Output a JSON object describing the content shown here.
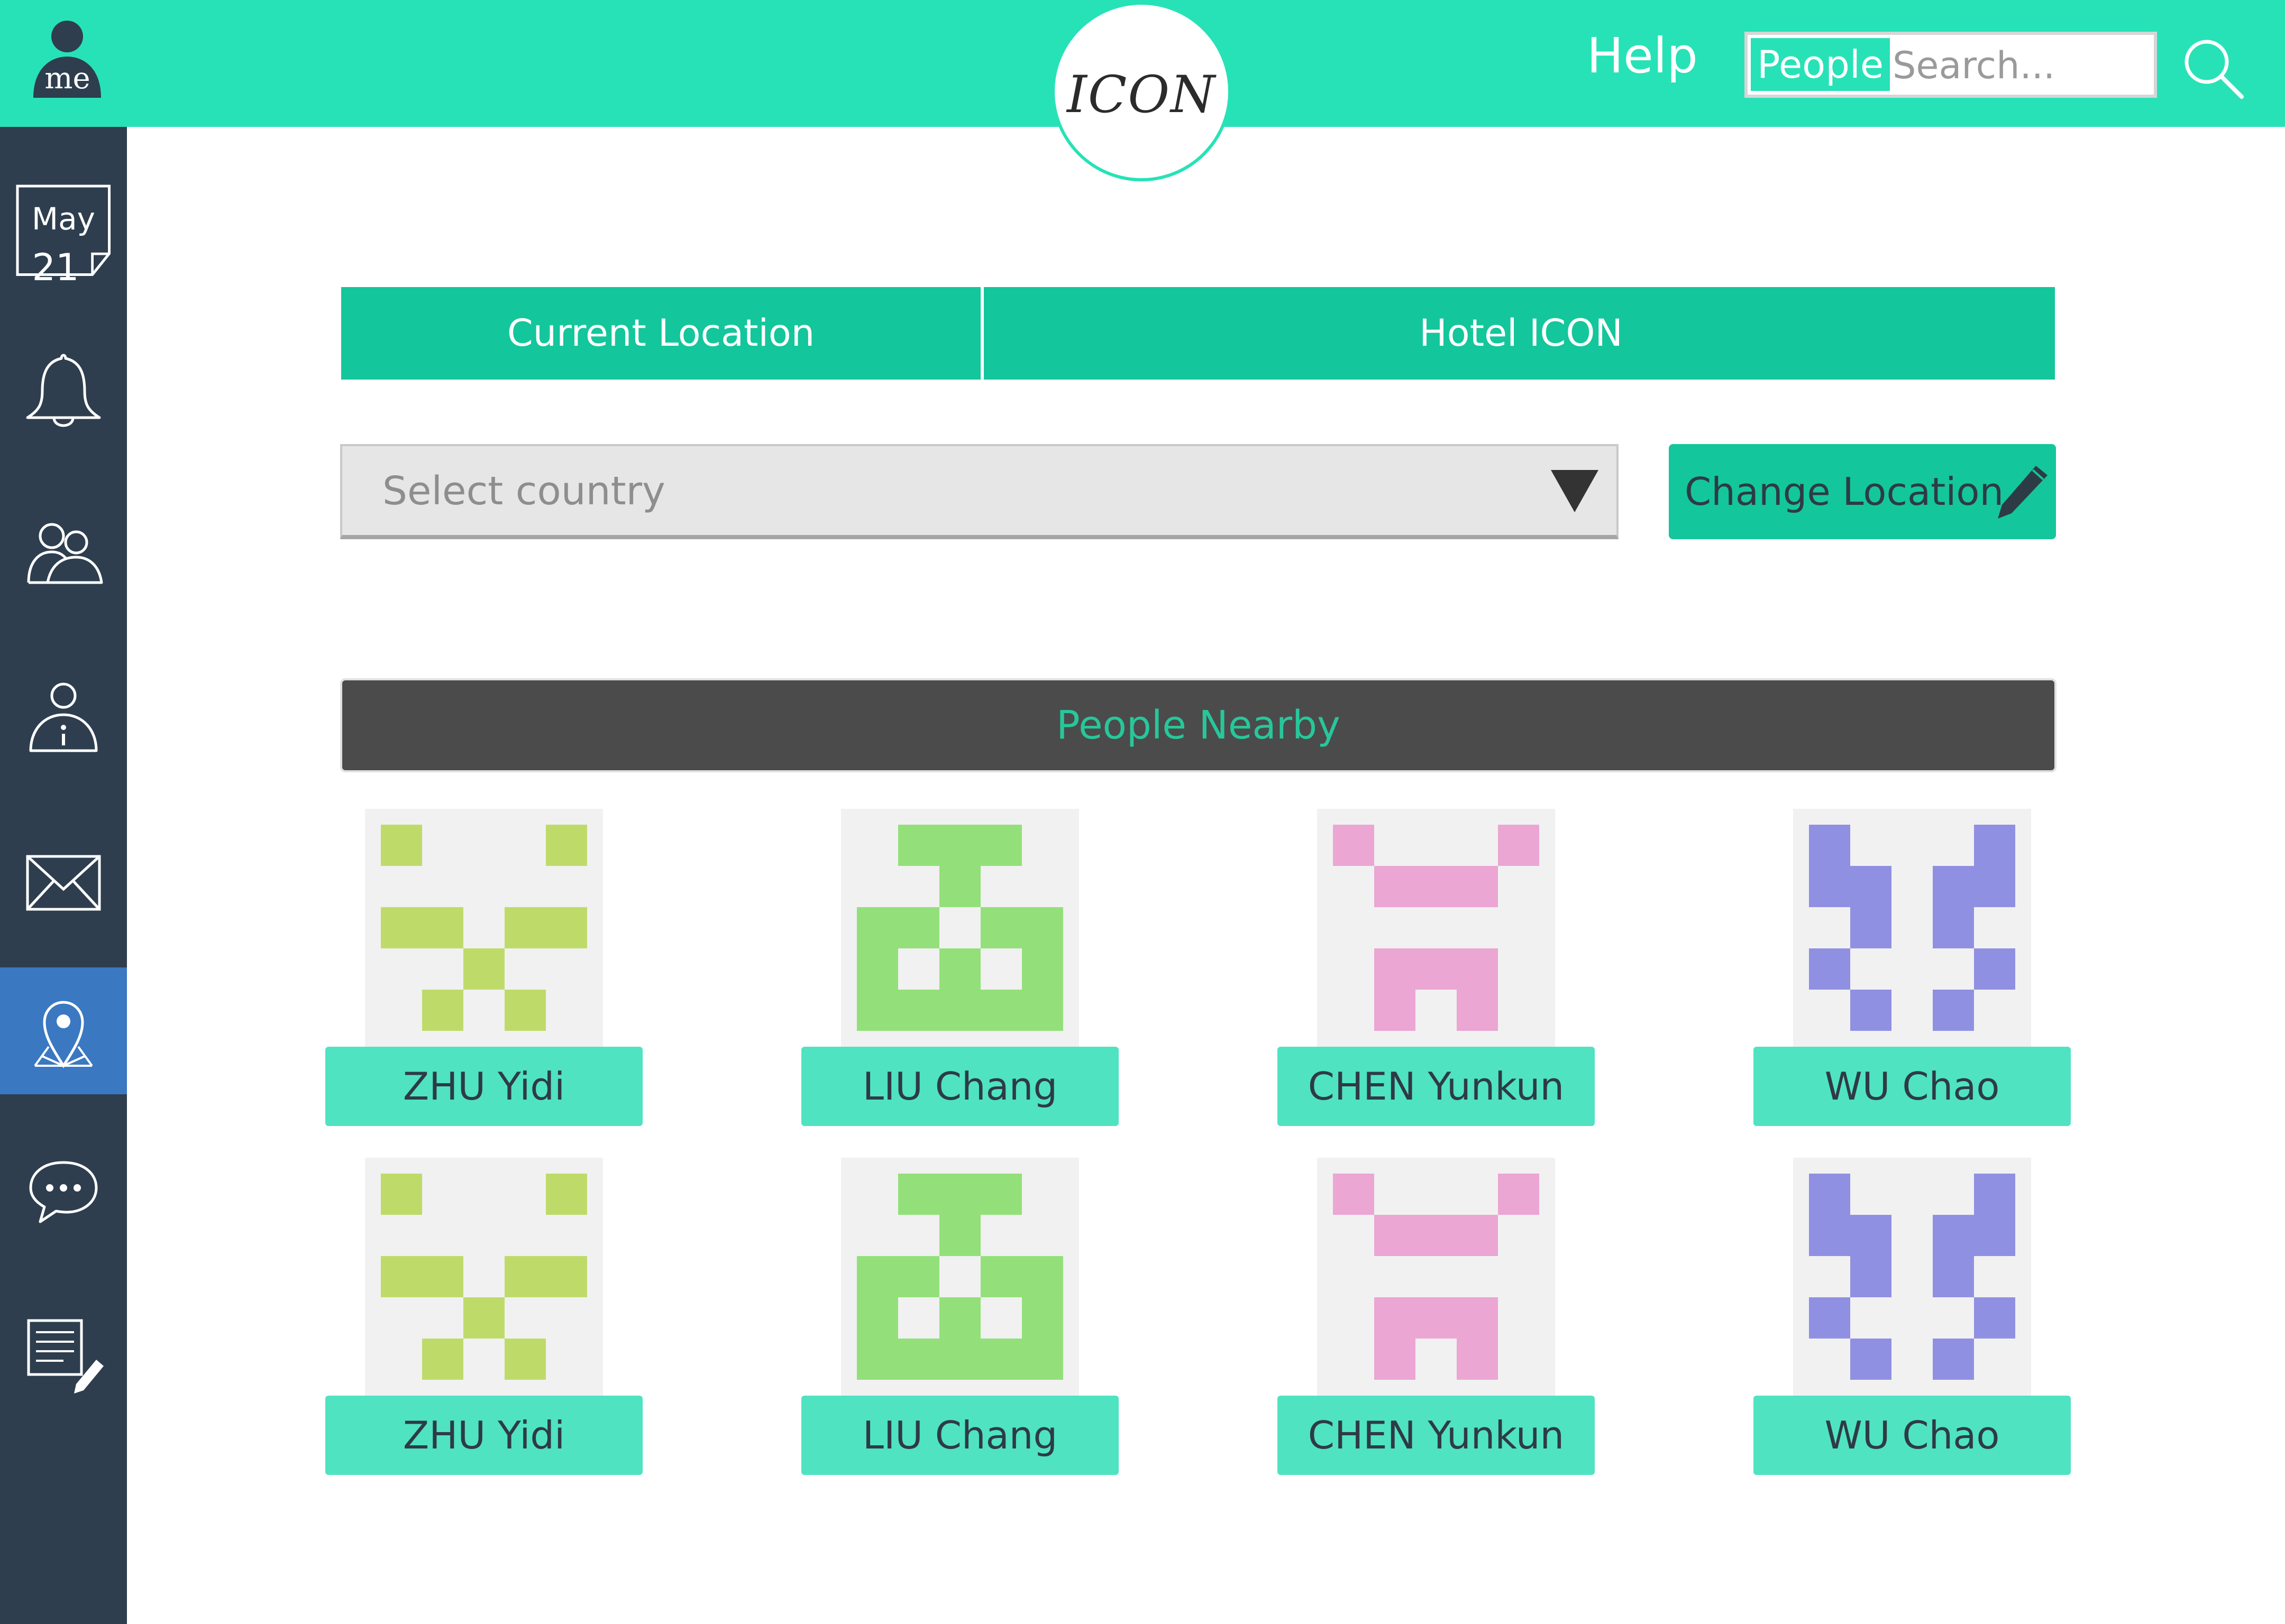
{
  "header": {
    "profile_label": "me",
    "logo_text": "ICON",
    "help_label": "Help",
    "search": {
      "scope": "People",
      "placeholder": "Search..."
    }
  },
  "sidebar": {
    "calendar": {
      "month": "May",
      "day": "21"
    },
    "items": [
      {
        "name": "calendar",
        "icon": "calendar-icon",
        "active": false
      },
      {
        "name": "notifications",
        "icon": "bell-icon",
        "active": false
      },
      {
        "name": "contacts",
        "icon": "people-icon",
        "active": false
      },
      {
        "name": "profile-info",
        "icon": "user-info-icon",
        "active": false
      },
      {
        "name": "mail",
        "icon": "envelope-icon",
        "active": false
      },
      {
        "name": "location",
        "icon": "map-pin-icon",
        "active": true
      },
      {
        "name": "chat",
        "icon": "chat-bubble-icon",
        "active": false
      },
      {
        "name": "notes",
        "icon": "edit-note-icon",
        "active": false
      }
    ]
  },
  "location": {
    "label": "Current Location",
    "value": "Hotel ICON",
    "country_placeholder": "Select country",
    "change_button": "Change Location"
  },
  "people": {
    "title": "People Nearby",
    "list": [
      {
        "name": "ZHU Yidi",
        "avatar": "identicon-zhu",
        "color": "#bedb6a"
      },
      {
        "name": "LIU Chang",
        "avatar": "identicon-liu",
        "color": "#93e07a"
      },
      {
        "name": "CHEN Yunkun",
        "avatar": "identicon-chen",
        "color": "#eba6d3"
      },
      {
        "name": "WU Chao",
        "avatar": "identicon-wu",
        "color": "#9090e3"
      },
      {
        "name": "ZHU Yidi",
        "avatar": "identicon-zhu",
        "color": "#bedb6a"
      },
      {
        "name": "LIU Chang",
        "avatar": "identicon-liu",
        "color": "#93e07a"
      },
      {
        "name": "CHEN Yunkun",
        "avatar": "identicon-chen",
        "color": "#eba6d3"
      },
      {
        "name": "WU Chao",
        "avatar": "identicon-wu",
        "color": "#9090e3"
      }
    ]
  },
  "colors": {
    "accent": "#27e2b7",
    "accent_dark": "#14c69b",
    "sidebar": "#2e3e4e",
    "active_nav": "#3a78c2"
  }
}
